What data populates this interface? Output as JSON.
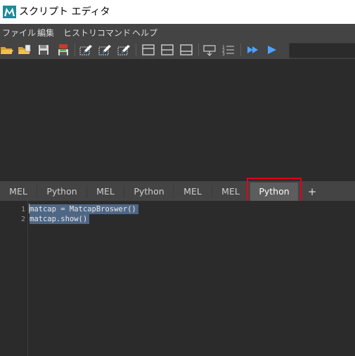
{
  "window": {
    "title": "スクリプト エディタ"
  },
  "menu": {
    "items": [
      "ファイル",
      "編集",
      "ヒストリ",
      "コマンド",
      "ヘルプ"
    ]
  },
  "toolbar": {
    "icons": [
      "load-script-icon",
      "source-script-icon",
      "save-script-icon",
      "save-script-to-shelf-icon",
      "clear-history-icon",
      "clear-input-icon",
      "clear-all-icon",
      "show-history-only-icon",
      "show-both-icon",
      "show-input-only-icon",
      "echo-all-commands-icon",
      "show-line-numbers-icon",
      "execute-all-icon",
      "execute-icon"
    ],
    "search_value": ""
  },
  "tabs": {
    "items": [
      "MEL",
      "Python",
      "MEL",
      "Python",
      "MEL",
      "MEL",
      "Python"
    ],
    "active_index": 6,
    "add_label": "+"
  },
  "editor": {
    "line_numbers": [
      "1",
      "2"
    ],
    "lines": [
      "matcap = MatcapBroswer()",
      "matcap.show()"
    ]
  },
  "colors": {
    "highlight_box": "#e0001b",
    "selection": "#4e6785",
    "editor_bg": "#2b2b2b",
    "chrome_bg": "#444444"
  }
}
